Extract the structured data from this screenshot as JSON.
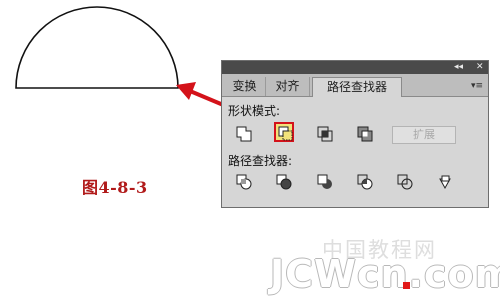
{
  "figure": {
    "caption": "图4-8-3"
  },
  "panel": {
    "titlebar": {
      "collapse_glyph": "◂◂",
      "close_glyph": "✕"
    },
    "tabs": [
      {
        "label": "变换",
        "active": false
      },
      {
        "label": "对齐",
        "active": false
      },
      {
        "label": "路径查找器",
        "active": true
      }
    ],
    "menu_glyph": "▾≡",
    "shape_modes": {
      "label": "形状模式:",
      "buttons": [
        {
          "name": "unite",
          "icon": "unite-icon",
          "highlighted": false
        },
        {
          "name": "minus-front",
          "icon": "minus-front-icon",
          "highlighted": true
        },
        {
          "name": "intersect",
          "icon": "intersect-icon",
          "highlighted": false
        },
        {
          "name": "exclude",
          "icon": "exclude-icon",
          "highlighted": false
        }
      ],
      "expand_label": "扩展"
    },
    "pathfinders": {
      "label": "路径查找器:",
      "buttons": [
        {
          "name": "divide",
          "icon": "divide-icon"
        },
        {
          "name": "trim",
          "icon": "trim-icon"
        },
        {
          "name": "merge",
          "icon": "merge-icon"
        },
        {
          "name": "crop",
          "icon": "crop-icon"
        },
        {
          "name": "outline",
          "icon": "outline-icon"
        },
        {
          "name": "minus-back",
          "icon": "minus-back-icon"
        }
      ]
    }
  },
  "watermark": {
    "top": "中国教程网",
    "main": "JCWcn.com"
  },
  "colors": {
    "arrow": "#d4121a",
    "highlight_fill": "#f2e27a",
    "caption": "#b11a1a"
  }
}
